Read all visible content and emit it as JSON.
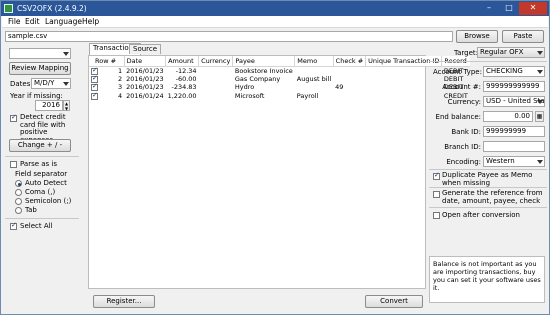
{
  "window": {
    "title": "CSV2OFX (2.4.9.2)"
  },
  "menu": [
    "File",
    "Edit",
    "Language",
    "Help"
  ],
  "file": {
    "path": "sample.csv",
    "browse_label": "Browse",
    "paste_label": "Paste"
  },
  "left": {
    "review_mapping_label": "Review Mapping",
    "dates_label": "Dates:",
    "dates_value": "M/D/Y",
    "year_label": "Year if missing:",
    "year_value": "2016",
    "detect_credit_label": "Detect credit card file with positive expenses",
    "change_sign_label": "Change + / -",
    "parse_as_is_label": "Parse as is",
    "field_separator_label": "Field separator",
    "separators": [
      "Auto Detect",
      "Coma (,)",
      "Semicolon (;)",
      "Tab"
    ],
    "select_all_label": "Select All"
  },
  "tabs": [
    "Transactions",
    "Source"
  ],
  "table": {
    "columns": [
      "Row #",
      "Date",
      "Amount",
      "Currency",
      "Payee",
      "Memo",
      "Check #",
      "Unique Transaction ID",
      "Record"
    ],
    "rows": [
      {
        "row": "1",
        "date": "2016/01/23",
        "amount": "-12.34",
        "currency": "",
        "payee": "Bookstore Invoice",
        "memo": "",
        "check": "",
        "uid": "",
        "record": "DEBIT"
      },
      {
        "row": "2",
        "date": "2016/01/23",
        "amount": "-60.00",
        "currency": "",
        "payee": "Gas Company",
        "memo": "August bill",
        "check": "",
        "uid": "",
        "record": "DEBIT"
      },
      {
        "row": "3",
        "date": "2016/01/23",
        "amount": "-234.83",
        "currency": "",
        "payee": "Hydro",
        "memo": "",
        "check": "49",
        "uid": "",
        "record": "DEBIT"
      },
      {
        "row": "4",
        "date": "2016/01/24",
        "amount": "1,220.00",
        "currency": "",
        "payee": "Microsoft",
        "memo": "Payroll",
        "check": "",
        "uid": "",
        "record": "CREDIT"
      }
    ]
  },
  "bottom": {
    "register_label": "Register...",
    "convert_label": "Convert"
  },
  "right": {
    "target_label": "Target:",
    "target_value": "Regular OFX",
    "account_type_label": "Account Type:",
    "account_type_value": "CHECKING",
    "account_no_label": "Account #:",
    "account_no_value": "999999999999",
    "currency_label": "Currency:",
    "currency_value": "USD - United Sta",
    "end_balance_label": "End balance:",
    "end_balance_value": "0.00",
    "bank_id_label": "Bank ID:",
    "bank_id_value": "999999999",
    "branch_id_label": "Branch ID:",
    "branch_id_value": "",
    "encoding_label": "Encoding:",
    "encoding_value": "Western",
    "duplicate_payee_label": "Duplicate Payee as Memo when missing",
    "generate_ref_label": "Generate the reference from date, amount, payee, check",
    "open_after_label": "Open after conversion",
    "info_text": "Balance is not important as you are importing transactions, buy you can set it your software uses it."
  }
}
